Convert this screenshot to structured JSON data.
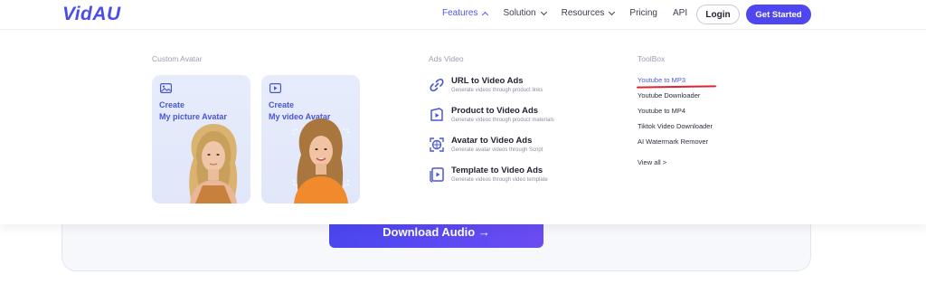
{
  "header": {
    "logo": "VidAU",
    "nav": [
      "Features",
      "Solution",
      "Resources",
      "Pricing",
      "API"
    ],
    "login": "Login",
    "get_started": "Get Started"
  },
  "dropdown": {
    "custom_avatar": {
      "title": "Custom Avatar",
      "cards": [
        {
          "line1": "Create",
          "line2": "My picture Avatar"
        },
        {
          "line1": "Create",
          "line2": "My video Avatar"
        }
      ]
    },
    "ads_video": {
      "title": "Ads Video",
      "items": [
        {
          "title": "URL to Video Ads",
          "desc": "Generate videos through product links"
        },
        {
          "title": "Product to Video Ads",
          "desc": "Generate videos through product materials"
        },
        {
          "title": "Avatar to Video Ads",
          "desc": "Generate avatar videos through Script"
        },
        {
          "title": "Template to Video Ads",
          "desc": "Generate videos through video template"
        }
      ]
    },
    "toolbox": {
      "title": "ToolBox",
      "items": [
        "Youtube to MP3",
        "Youtube Downloader",
        "Youtube to MP4",
        "Tiktok Video Downloader",
        "AI Watermark Remover"
      ],
      "view_all": "View all >"
    }
  },
  "page": {
    "download_button": "Download Audio →"
  },
  "colors": {
    "brand": "#4f46f0",
    "accent_text": "#5357e8",
    "annotation": "#e0232e"
  }
}
